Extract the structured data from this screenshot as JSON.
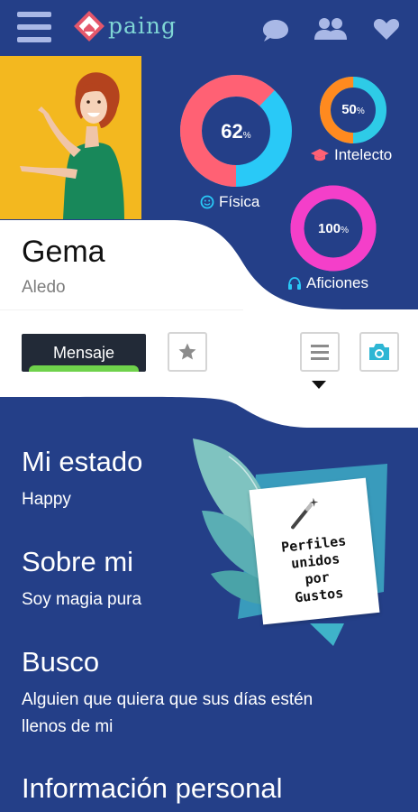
{
  "app": {
    "logo_text": "paing"
  },
  "profile": {
    "name": "Gema",
    "location": "Aledo"
  },
  "stats": [
    {
      "key": "fisica",
      "value": "62",
      "unit": "%",
      "label": "Física",
      "percent": 62,
      "colors": [
        "#ff6174",
        "#29c9f7"
      ]
    },
    {
      "key": "intelecto",
      "value": "50",
      "unit": "%",
      "label": "Intelecto",
      "percent": 50,
      "colors": [
        "#ff8a1f",
        "#2ecbe7"
      ]
    },
    {
      "key": "aficiones",
      "value": "100",
      "unit": "%",
      "label": "Aficiones",
      "percent": 100,
      "colors": [
        "#f43fc9",
        "#f43fc9"
      ]
    }
  ],
  "actions": {
    "message_label": "Mensaje"
  },
  "sections": {
    "estado": {
      "title": "Mi estado",
      "text": "Happy"
    },
    "sobre": {
      "title": "Sobre mi",
      "text": "Soy magia pura"
    },
    "busco": {
      "title": "Busco",
      "text_line1": "Alguien que quiera que sus días estén",
      "text_line2": "llenos de mi"
    },
    "info": {
      "title": "Información personal"
    }
  },
  "promo": {
    "line1": "Perfiles",
    "line2": "unidos",
    "line3": "por",
    "line4": "Gustos"
  },
  "colors": {
    "header_bg": "#243f88",
    "accent": "#7fd6d5",
    "message_button": "#222a37",
    "message_bar": "#6fd24b"
  },
  "icons": [
    "menu-icon",
    "chat-icon",
    "users-icon",
    "heart-icon",
    "smile-icon",
    "graduation-cap-icon",
    "headphones-icon",
    "star-icon",
    "list-icon",
    "camera-icon",
    "magic-wand-icon"
  ]
}
